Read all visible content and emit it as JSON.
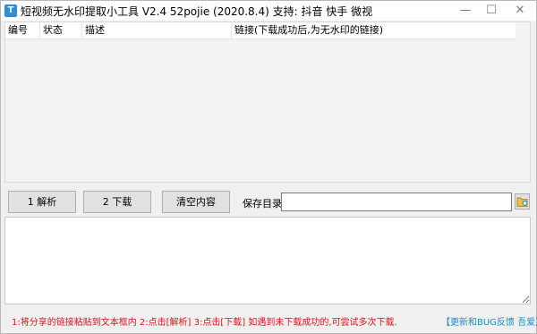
{
  "window": {
    "title": "短视频无水印提取小工具 V2.4  52pojie (2020.8.4)   支持: 抖音 快手 微视",
    "app_icon_glyph": "T",
    "controls": {
      "minimize": "—",
      "maximize": "☐",
      "close": "✕"
    }
  },
  "table": {
    "columns": [
      "编号",
      "状态",
      "描述",
      "链接(下载成功后,为无水印的链接)"
    ],
    "rows": []
  },
  "toolbar": {
    "parse_label": "1 解析",
    "download_label": "2 下载",
    "clear_label": "清空内容",
    "save_dir_label": "保存目录",
    "save_dir_value": ""
  },
  "log": {
    "text": ""
  },
  "footer": {
    "hint": "1:将分享的链接粘贴到文本框内  2:点击[解析]  3:点击[下载]  如遇到未下载成功的,可尝试多次下载.",
    "feedback_link": "【更新和BUG反馈 吾爱】"
  },
  "colors": {
    "hint": "#e0141e",
    "link": "#1a8bc6"
  }
}
